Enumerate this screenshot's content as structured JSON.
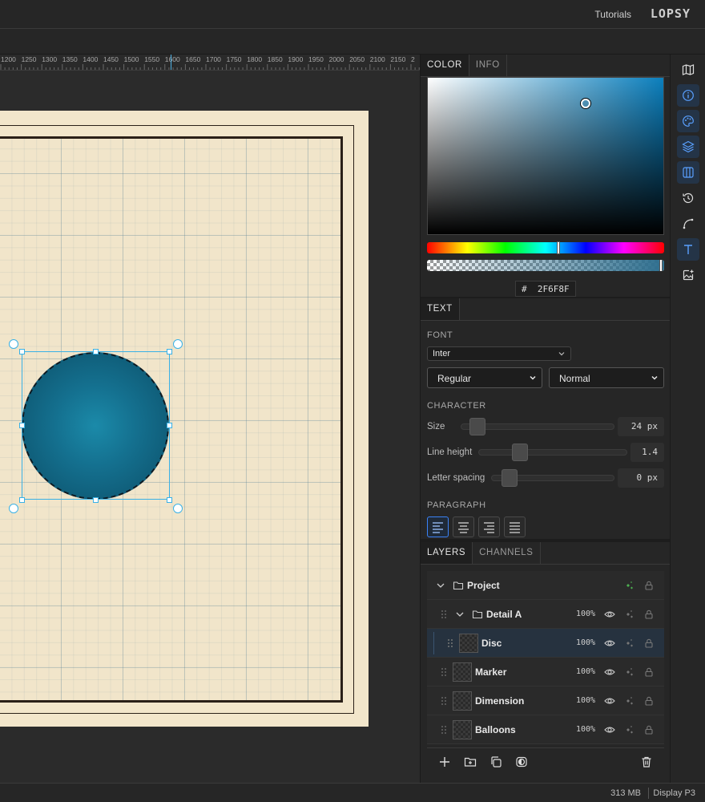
{
  "topbar": {
    "tutorials": "Tutorials",
    "logo": "LOPSY"
  },
  "ruler": {
    "labels": [
      "1200",
      "1250",
      "1300",
      "1350",
      "1400",
      "1450",
      "1500",
      "1550",
      "1600",
      "1650",
      "1700",
      "1750",
      "1800",
      "1850",
      "1900",
      "1950",
      "2000",
      "2050",
      "2100",
      "2150",
      "2"
    ]
  },
  "color_panel": {
    "tabs": [
      "COLOR",
      "INFO"
    ],
    "hex_prefix": "#",
    "hex": "2F6F8F",
    "accent": "#2F6F8F"
  },
  "text_panel": {
    "tab": "TEXT",
    "font_label": "FONT",
    "font_family": "Inter",
    "font_weight": "Regular",
    "font_style": "Normal",
    "character_label": "CHARACTER",
    "size_label": "Size",
    "size_value": "24 px",
    "line_height_label": "Line height",
    "line_height_value": "1.4",
    "letter_spacing_label": "Letter spacing",
    "letter_spacing_value": "0 px",
    "paragraph_label": "PARAGRAPH",
    "alignment": "left"
  },
  "layers_panel": {
    "tabs": [
      "LAYERS",
      "CHANNELS"
    ],
    "layers": [
      {
        "name": "Project",
        "opacity": ""
      },
      {
        "name": "Detail A",
        "opacity": "100%"
      },
      {
        "name": "Disc",
        "opacity": "100%"
      },
      {
        "name": "Marker",
        "opacity": "100%"
      },
      {
        "name": "Dimension",
        "opacity": "100%"
      },
      {
        "name": "Balloons",
        "opacity": "100%"
      }
    ]
  },
  "status": {
    "memory": "313 MB",
    "display": "Display P3"
  },
  "rail_icons": [
    "map-icon",
    "info-icon",
    "palette-icon",
    "layers-icon",
    "columns-icon",
    "history-icon",
    "pen-curve-icon",
    "text-icon",
    "image-add-icon"
  ]
}
